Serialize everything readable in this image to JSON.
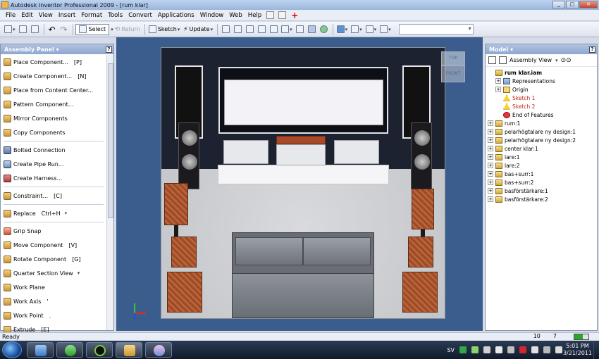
{
  "window": {
    "title": "Autodesk Inventor Professional 2009 - [rum klar]",
    "btn_min": "_",
    "btn_max": "□",
    "btn_close": "✕"
  },
  "menu": [
    "File",
    "Edit",
    "View",
    "Insert",
    "Format",
    "Tools",
    "Convert",
    "Applications",
    "Window",
    "Web",
    "Help"
  ],
  "menu_extra": {
    "plus": "+"
  },
  "toolbar": {
    "select_label": "Select",
    "return_label": "Return",
    "sketch_label": "Sketch",
    "update_label": "Update"
  },
  "left_panel": {
    "title": "Assembly Panel ▾",
    "help": "?",
    "commands": [
      {
        "label": "Place Component...",
        "shortcut": "[P]"
      },
      {
        "label": "Create Component...",
        "shortcut": "[N]"
      },
      {
        "label": "Place from Content Center...",
        "shortcut": ""
      },
      {
        "label": "Pattern Component...",
        "shortcut": ""
      },
      {
        "label": "Mirror Components",
        "shortcut": ""
      },
      {
        "label": "Copy Components",
        "shortcut": ""
      },
      {
        "label": "Bolted Connection",
        "shortcut": ""
      },
      {
        "label": "Create Pipe Run...",
        "shortcut": ""
      },
      {
        "label": "Create Harness...",
        "shortcut": ""
      },
      {
        "label": "Constraint...",
        "shortcut": "[C]"
      },
      {
        "label": "Replace",
        "shortcut": "Ctrl+H"
      },
      {
        "label": "Grip Snap",
        "shortcut": ""
      },
      {
        "label": "Move Component",
        "shortcut": "[V]"
      },
      {
        "label": "Rotate Component",
        "shortcut": "[G]"
      },
      {
        "label": "Quarter Section View",
        "shortcut": ""
      },
      {
        "label": "Work Plane",
        "shortcut": ""
      },
      {
        "label": "Work Axis",
        "shortcut": "'"
      },
      {
        "label": "Work Point",
        "shortcut": "."
      },
      {
        "label": "Extrude",
        "shortcut": "[E]"
      }
    ]
  },
  "viewcube": {
    "top": "TOP",
    "front": "FRONT"
  },
  "right_panel": {
    "title": "Model ▾",
    "help": "?",
    "view_label": "Assembly View",
    "tree": [
      {
        "label": "rum klar.iam",
        "level": 0,
        "expander": "",
        "icon": "assembly",
        "style": "bold"
      },
      {
        "label": "Representations",
        "level": 1,
        "expander": "+",
        "icon": "rep",
        "style": ""
      },
      {
        "label": "Origin",
        "level": 1,
        "expander": "+",
        "icon": "folder",
        "style": ""
      },
      {
        "label": "Sketch 1",
        "level": 1,
        "expander": "",
        "icon": "warn",
        "style": "red"
      },
      {
        "label": "Sketch 2",
        "level": 1,
        "expander": "",
        "icon": "warn",
        "style": "red"
      },
      {
        "label": "End of Features",
        "level": 1,
        "expander": "",
        "icon": "end",
        "style": ""
      },
      {
        "label": "rum:1",
        "level": 0,
        "expander": "+",
        "icon": "part",
        "style": ""
      },
      {
        "label": "pelarhögtalare ny design:1",
        "level": 0,
        "expander": "+",
        "icon": "part",
        "style": ""
      },
      {
        "label": "pelarhögtalare ny design:2",
        "level": 0,
        "expander": "+",
        "icon": "part",
        "style": ""
      },
      {
        "label": "center klar:1",
        "level": 0,
        "expander": "+",
        "icon": "part",
        "style": ""
      },
      {
        "label": "lare:1",
        "level": 0,
        "expander": "+",
        "icon": "part",
        "style": ""
      },
      {
        "label": "lare:2",
        "level": 0,
        "expander": "+",
        "icon": "part",
        "style": ""
      },
      {
        "label": "bas+surr:1",
        "level": 0,
        "expander": "+",
        "icon": "part",
        "style": ""
      },
      {
        "label": "bas+surr:2",
        "level": 0,
        "expander": "+",
        "icon": "part",
        "style": ""
      },
      {
        "label": "basförstärkare:1",
        "level": 0,
        "expander": "+",
        "icon": "part",
        "style": ""
      },
      {
        "label": "basförstärkare:2",
        "level": 0,
        "expander": "+",
        "icon": "part",
        "style": ""
      }
    ]
  },
  "status": {
    "text": "Ready",
    "num1": "10",
    "num2": "7"
  },
  "taskbar": {
    "lang": "SV",
    "time": "5:01 PM",
    "date": "3/21/2011"
  }
}
